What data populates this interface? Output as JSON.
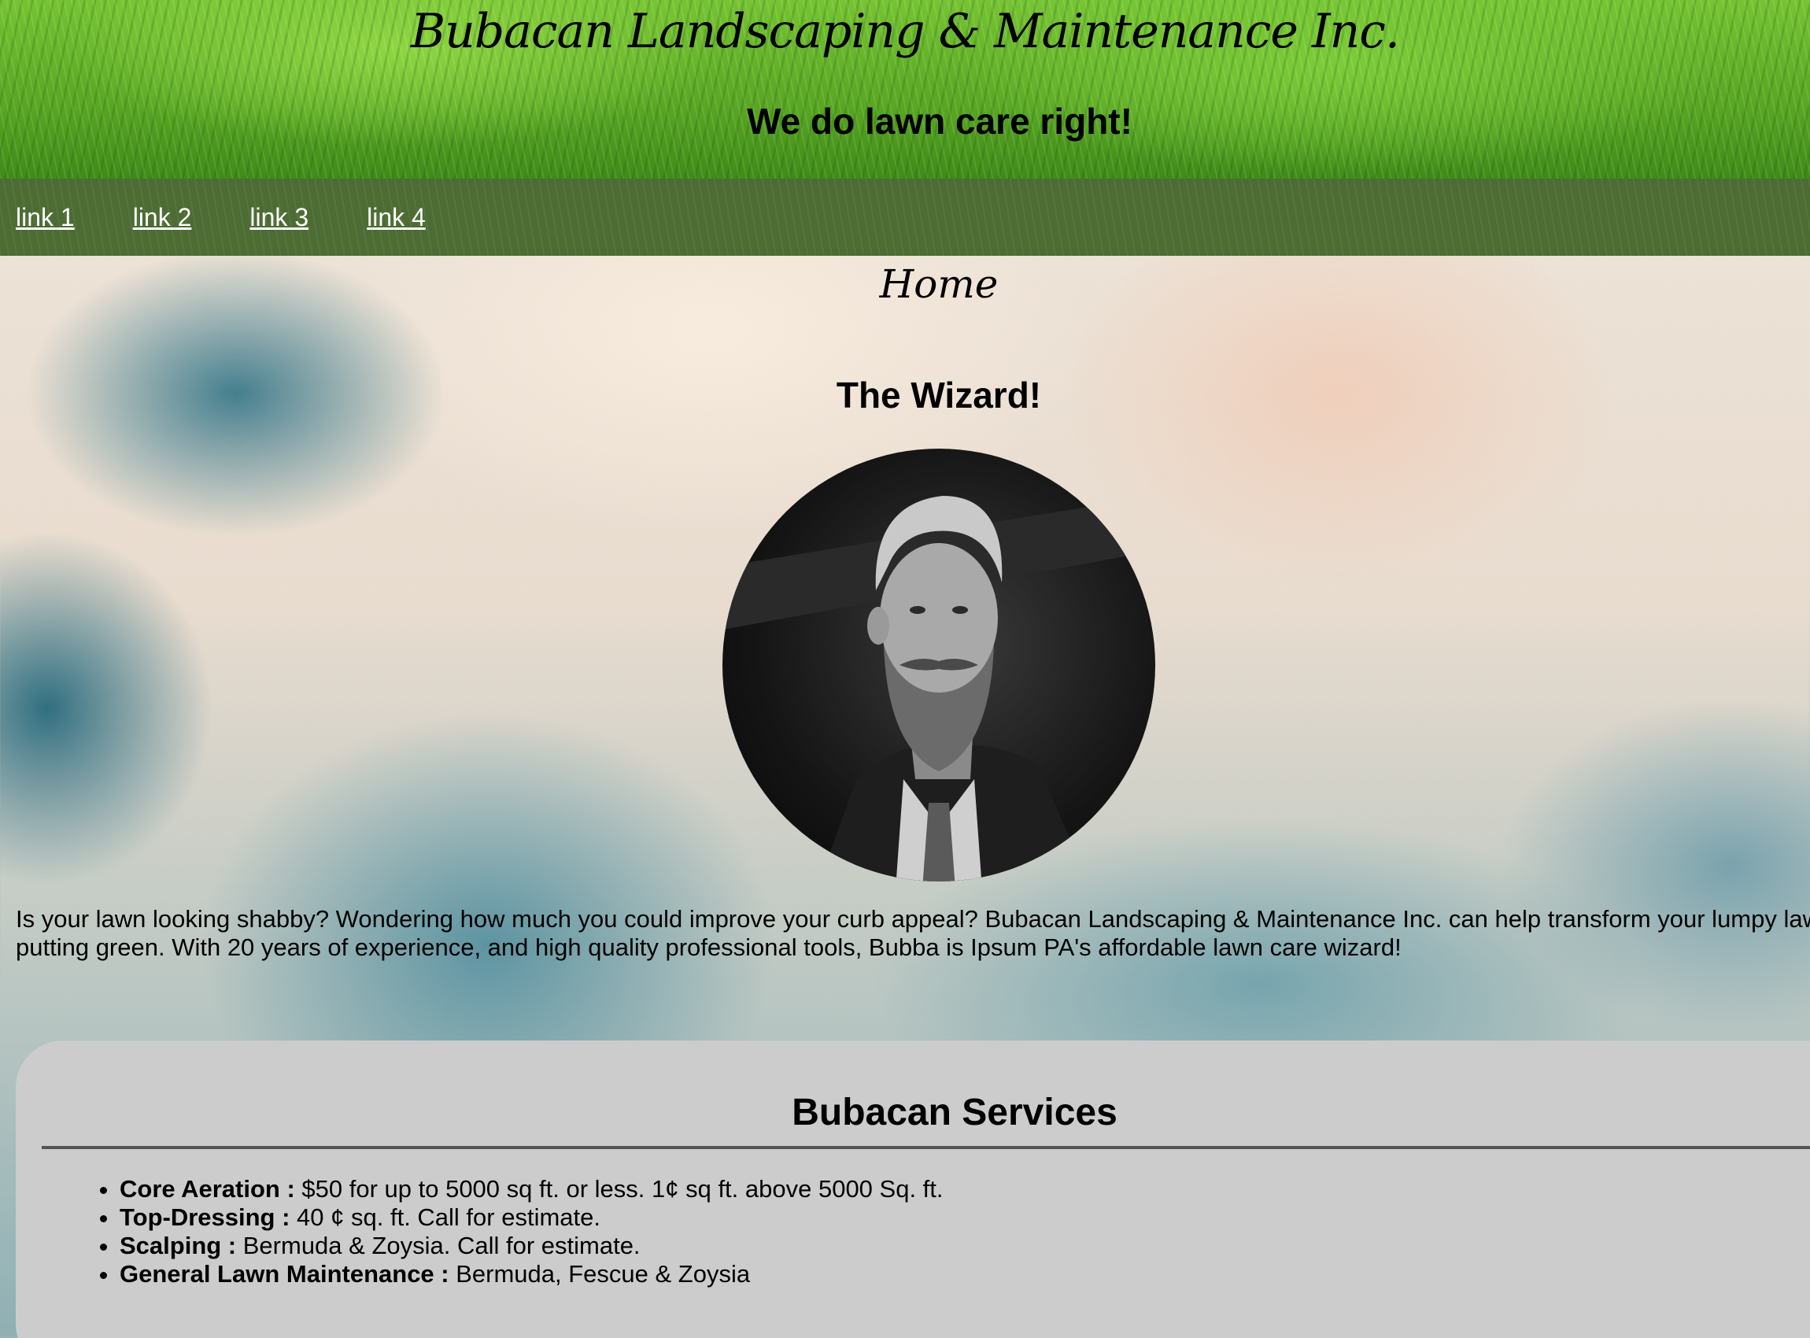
{
  "header": {
    "title": "Bubacan Landscaping & Maintenance Inc.",
    "tagline": "We do lawn care right!"
  },
  "nav": {
    "links": [
      "link 1",
      "link 2",
      "link 3",
      "link 4"
    ]
  },
  "main": {
    "page_heading": "Home",
    "profile_heading": "The Wizard!",
    "intro": "Is your lawn looking shabby? Wondering how much you could improve your curb appeal? Bubacan Landscaping & Maintenance Inc. can help transform your lumpy lawn into a putting green. With 20 years of experience, and high quality professional tools, Bubba is Ipsum PA's affordable lawn care wizard!"
  },
  "services": {
    "heading": "Bubacan Services",
    "items": [
      {
        "name": "Core Aeration :",
        "detail": " $50 for up to 5000 sq ft. or less. 1¢ sq ft. above 5000 Sq. ft."
      },
      {
        "name": "Top-Dressing :",
        "detail": " 40 ¢ sq. ft. Call for estimate."
      },
      {
        "name": "Scalping :",
        "detail": " Bermuda & Zoysia. Call for estimate."
      },
      {
        "name": "General Lawn Maintenance :",
        "detail": " Bermuda, Fescue & Zoysia"
      }
    ]
  },
  "colors": {
    "nav_background": "#4c6c34",
    "nav_link": "#ffffff",
    "card_background": "#cccccc"
  }
}
